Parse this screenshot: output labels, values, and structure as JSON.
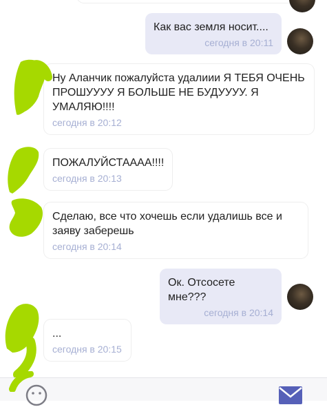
{
  "messages": [
    {
      "direction": "out",
      "text": "Как вас земля носит....",
      "time": "сегодня в 20:11"
    },
    {
      "direction": "in",
      "text": "Ну Аланчик пожалуйста удалиии Я ТЕБЯ ОЧЕНЬ ПРОШУУУУ Я БОЛЬШЕ НЕ БУДУУУУ. Я УМАЛЯЮ!!!!",
      "time": "сегодня в 20:12"
    },
    {
      "direction": "in",
      "text": "ПОЖАЛУЙСТАААА!!!!",
      "time": "сегодня в 20:13"
    },
    {
      "direction": "in",
      "text": "Сделаю, все что хочешь если удалишь все и заяву заберешь",
      "time": "сегодня в 20:14"
    },
    {
      "direction": "out",
      "text": "Ок. Отсосете мне???",
      "time": "сегодня в 20:14"
    },
    {
      "direction": "in",
      "text": "...",
      "time": "сегодня в 20:15"
    }
  ],
  "icons": {
    "emoji": "emoji-icon",
    "send": "send-mail-icon",
    "avatar": "user-avatar"
  },
  "colors": {
    "outgoing_bubble": "#e8e9f6",
    "incoming_bubble": "#ffffff",
    "timestamp": "#a6afd3",
    "scribble": "#a6d900"
  }
}
